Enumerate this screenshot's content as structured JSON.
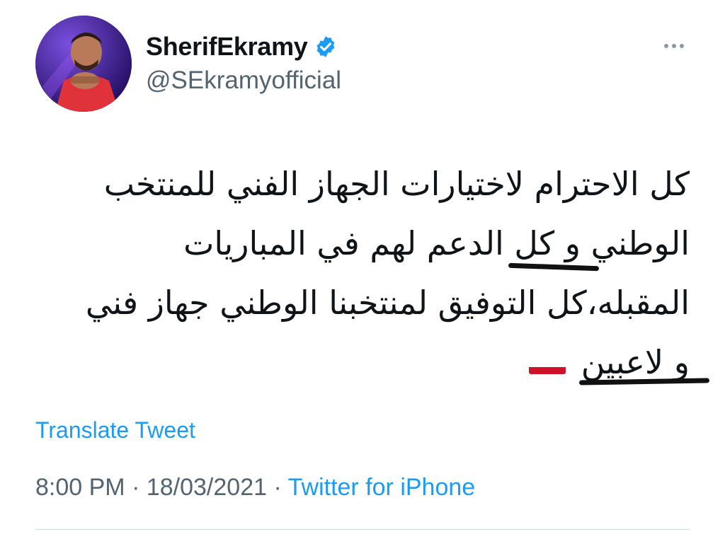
{
  "author": {
    "display_name": "SherifEkramy",
    "handle": "@SEkramyofficial",
    "verified": true,
    "verified_icon": "verified-badge-icon",
    "avatar_icon": "avatar-photo"
  },
  "tweet": {
    "lines": [
      "كل الاحترام لاختيارات الجهاز الفني للمنتخب",
      "الوطني و كل الدعم لهم في المباريات",
      "المقبله،كل التوفيق لمنتخبنا الوطني جهاز فني",
      "و لاعبين"
    ],
    "flag_emoji": "egypt-flag-icon"
  },
  "actions": {
    "translate_label": "Translate Tweet",
    "more_icon": "more-options-icon"
  },
  "meta": {
    "time": "8:00 PM",
    "separator": " · ",
    "date": "18/03/2021",
    "source": "Twitter for iPhone"
  },
  "colors": {
    "link_blue": "#1d9bf0",
    "secondary_text": "#536471",
    "primary_text": "#0f1419"
  }
}
